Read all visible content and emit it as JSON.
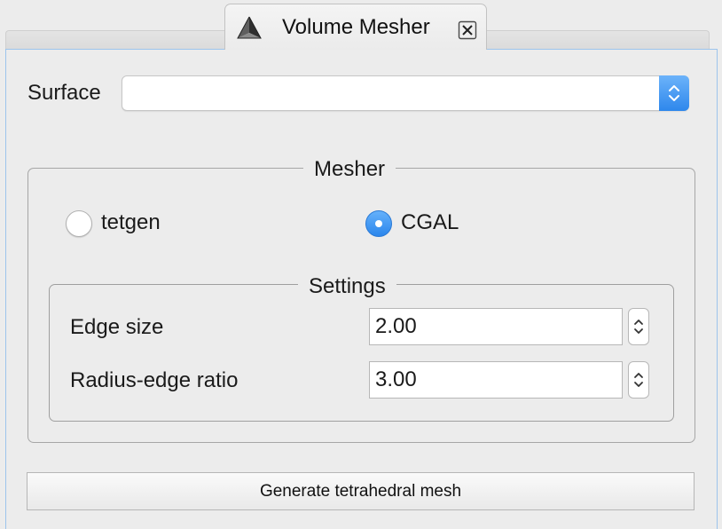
{
  "tab": {
    "title": "Volume Mesher",
    "icon": "pyramid-icon",
    "close_icon": "close-icon"
  },
  "surface": {
    "label": "Surface",
    "value": "",
    "arrow_icon": "updown-chevron-icon"
  },
  "mesher": {
    "title": "Mesher",
    "options": [
      {
        "label": "tetgen",
        "selected": false
      },
      {
        "label": "CGAL",
        "selected": true
      }
    ]
  },
  "settings": {
    "title": "Settings",
    "fields": [
      {
        "label": "Edge size",
        "value": "2.00"
      },
      {
        "label": "Radius-edge ratio",
        "value": "3.00"
      }
    ]
  },
  "actions": {
    "generate_label": "Generate tetrahedral mesh"
  },
  "colors": {
    "accent": "#3b8ff0",
    "panel_border": "#9cc4ec",
    "background": "#ececec"
  }
}
